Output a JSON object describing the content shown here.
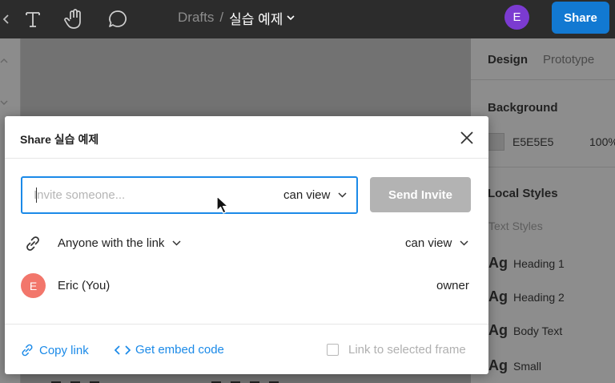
{
  "toolbar": {
    "breadcrumb_root": "Drafts",
    "breadcrumb_sep": "/",
    "file_name": "실습 예제",
    "user_initial": "E",
    "share_label": "Share",
    "icons": [
      "chevron-left-icon",
      "text-tool-icon",
      "hand-tool-icon",
      "comment-icon",
      "chevron-down-icon"
    ]
  },
  "right_panel": {
    "tabs": [
      "Design",
      "Prototype"
    ],
    "background_title": "Background",
    "background_hex": "E5E5E5",
    "background_opacity": "100%",
    "local_styles_title": "Local Styles",
    "text_styles_label": "Text Styles",
    "style_glyph": "Ag",
    "text_styles": [
      "Heading 1",
      "Heading 2",
      "Body Text",
      "Small"
    ]
  },
  "modal": {
    "title": "Share 실습 예제",
    "invite": {
      "placeholder": "Invite someone...",
      "value": "",
      "permission": "can view",
      "send_label": "Send Invite"
    },
    "link_access": {
      "scope": "Anyone with the link",
      "permission": "can view"
    },
    "users": [
      {
        "initial": "E",
        "name": "Eric (You)",
        "role": "owner"
      }
    ],
    "footer": {
      "copy_link": "Copy link",
      "embed_code": "Get embed code",
      "link_to_frame": "Link to selected frame",
      "link_to_frame_checked": false
    }
  },
  "colors": {
    "accent": "#1b8ae8",
    "share_button": "#1279d2",
    "avatar_top": "#7b3bd1",
    "avatar_user": "#f2766b",
    "send_disabled": "#b3b3b3"
  }
}
